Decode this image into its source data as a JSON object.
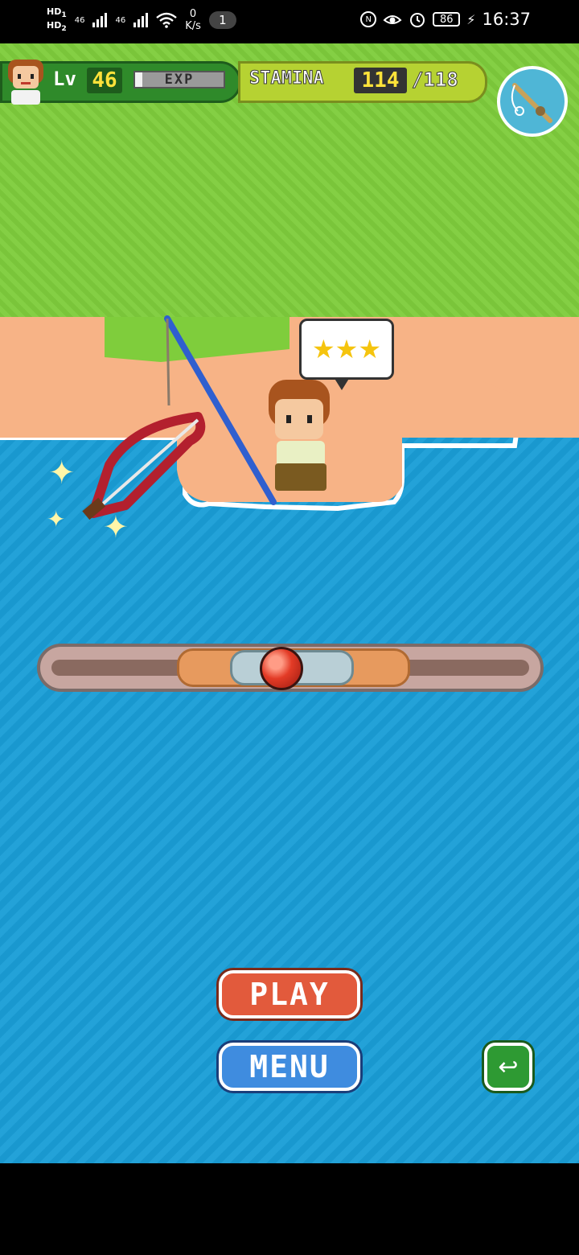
{
  "status_bar": {
    "hd1": "HD",
    "hd1_sub": "1",
    "hd2": "HD",
    "hd2_sub": "2",
    "net1": "46",
    "net2": "46",
    "speed_value": "0",
    "speed_unit": "K/s",
    "notification_count": "1",
    "nfc_icon": "nfc-icon",
    "eye_icon": "eye-comfort-icon",
    "alarm_icon": "alarm-icon",
    "battery": "86",
    "time": "16:37"
  },
  "hud": {
    "level_label": "Lv",
    "level": "46",
    "exp_label": "EXP",
    "exp_fraction": 0.08,
    "stamina_label": "STAMINA",
    "stamina": "114",
    "stamina_max": "/118",
    "rod_button_icon": "fishing-rod-icon"
  },
  "catch": {
    "stars": "★★★",
    "item_icon": "bow-icon",
    "player_icon": "fisher-character-icon"
  },
  "meter": {
    "indicator_position": 0.48
  },
  "buttons": {
    "play": "PLAY",
    "menu": "MENU",
    "back_icon": "back-arrow-icon",
    "back_glyph": "↩"
  },
  "colors": {
    "grass": "#7fcd3c",
    "sand": "#f7b386",
    "sea": "#1a9ed7",
    "play": "#e25a3c",
    "menu": "#3f8cdf",
    "back": "#2e9a33"
  }
}
